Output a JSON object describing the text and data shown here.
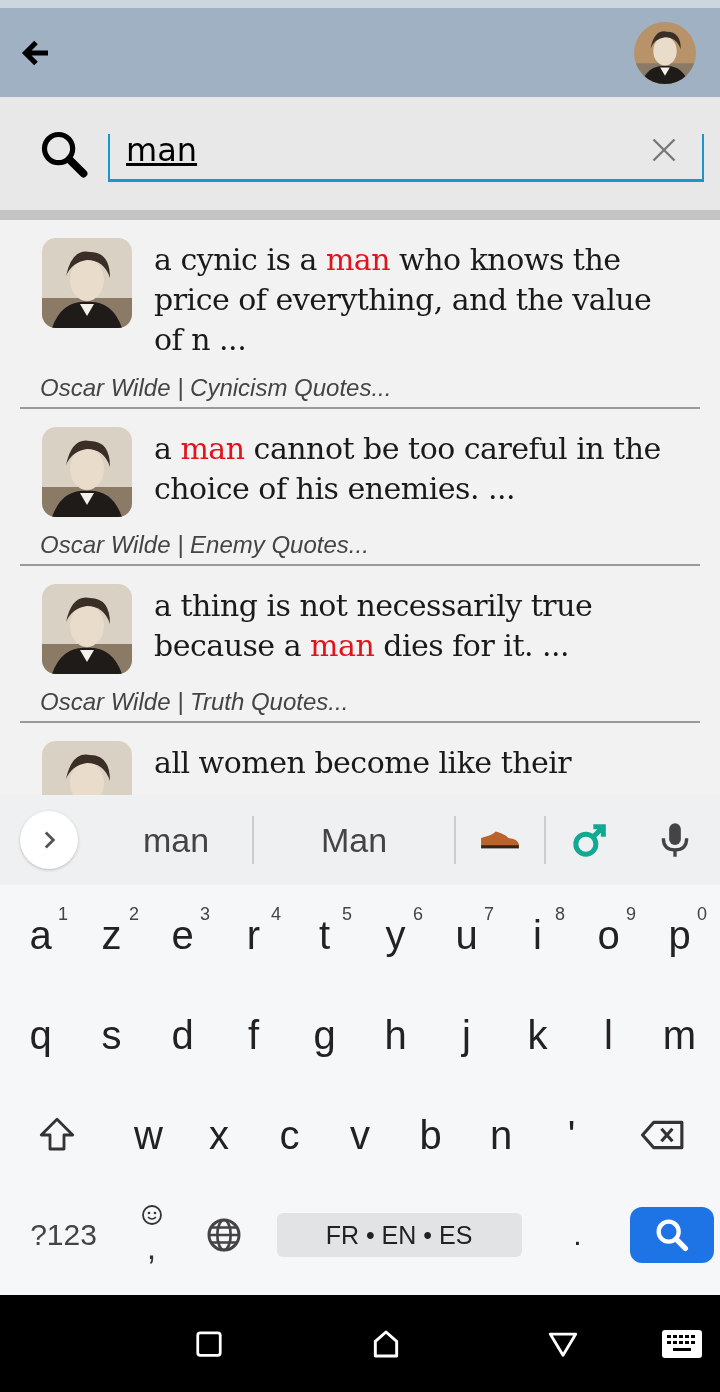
{
  "search": {
    "value": "man"
  },
  "results": [
    {
      "quote": [
        {
          "text": "a cynic is a ",
          "highlighted": false
        },
        {
          "text": "man",
          "highlighted": true
        },
        {
          "text": " who knows the price of everything, and the value of n ...",
          "highlighted": false
        }
      ],
      "source": "Oscar Wilde | Cynicism Quotes..."
    },
    {
      "quote": [
        {
          "text": "a ",
          "highlighted": false
        },
        {
          "text": "man",
          "highlighted": true
        },
        {
          "text": " cannot be too careful in the choice of his enemies. ...",
          "highlighted": false
        }
      ],
      "source": "Oscar Wilde | Enemy Quotes..."
    },
    {
      "quote": [
        {
          "text": "a thing is not necessarily true because a ",
          "highlighted": false
        },
        {
          "text": "man",
          "highlighted": true
        },
        {
          "text": " dies for it. ...",
          "highlighted": false
        }
      ],
      "source": "Oscar Wilde | Truth Quotes..."
    },
    {
      "quote": [
        {
          "text": "all women become like their",
          "highlighted": false
        }
      ]
    }
  ],
  "keyboard": {
    "suggestions": [
      {
        "kind": "word",
        "label": "man"
      },
      {
        "kind": "word",
        "label": "Man"
      },
      {
        "kind": "shoe"
      },
      {
        "kind": "male-sign"
      }
    ],
    "rows": [
      {
        "keys": [
          {
            "kind": "letter",
            "label": "a",
            "hint": "1"
          },
          {
            "kind": "letter",
            "label": "z",
            "hint": "2"
          },
          {
            "kind": "letter",
            "label": "e",
            "hint": "3"
          },
          {
            "kind": "letter",
            "label": "r",
            "hint": "4"
          },
          {
            "kind": "letter",
            "label": "t",
            "hint": "5"
          },
          {
            "kind": "letter",
            "label": "y",
            "hint": "6"
          },
          {
            "kind": "letter",
            "label": "u",
            "hint": "7"
          },
          {
            "kind": "letter",
            "label": "i",
            "hint": "8"
          },
          {
            "kind": "letter",
            "label": "o",
            "hint": "9"
          },
          {
            "kind": "letter",
            "label": "p",
            "hint": "0"
          }
        ]
      },
      {
        "keys": [
          {
            "kind": "letter",
            "label": "q"
          },
          {
            "kind": "letter",
            "label": "s"
          },
          {
            "kind": "letter",
            "label": "d"
          },
          {
            "kind": "letter",
            "label": "f"
          },
          {
            "kind": "letter",
            "label": "g"
          },
          {
            "kind": "letter",
            "label": "h"
          },
          {
            "kind": "letter",
            "label": "j"
          },
          {
            "kind": "letter",
            "label": "k"
          },
          {
            "kind": "letter",
            "label": "l"
          },
          {
            "kind": "letter",
            "label": "m"
          }
        ]
      },
      {
        "keys": [
          {
            "kind": "shift"
          },
          {
            "kind": "letter",
            "label": "w"
          },
          {
            "kind": "letter",
            "label": "x"
          },
          {
            "kind": "letter",
            "label": "c"
          },
          {
            "kind": "letter",
            "label": "v"
          },
          {
            "kind": "letter",
            "label": "b"
          },
          {
            "kind": "letter",
            "label": "n"
          },
          {
            "kind": "letter",
            "label": "'"
          },
          {
            "kind": "backspace"
          }
        ]
      },
      {
        "keys": [
          {
            "kind": "symbols",
            "label": "?123"
          },
          {
            "kind": "emoji-comma",
            "label": ","
          },
          {
            "kind": "globe"
          },
          {
            "kind": "space",
            "label": "FR • EN • ES"
          },
          {
            "kind": "period",
            "label": "."
          },
          {
            "kind": "search"
          }
        ]
      }
    ]
  }
}
